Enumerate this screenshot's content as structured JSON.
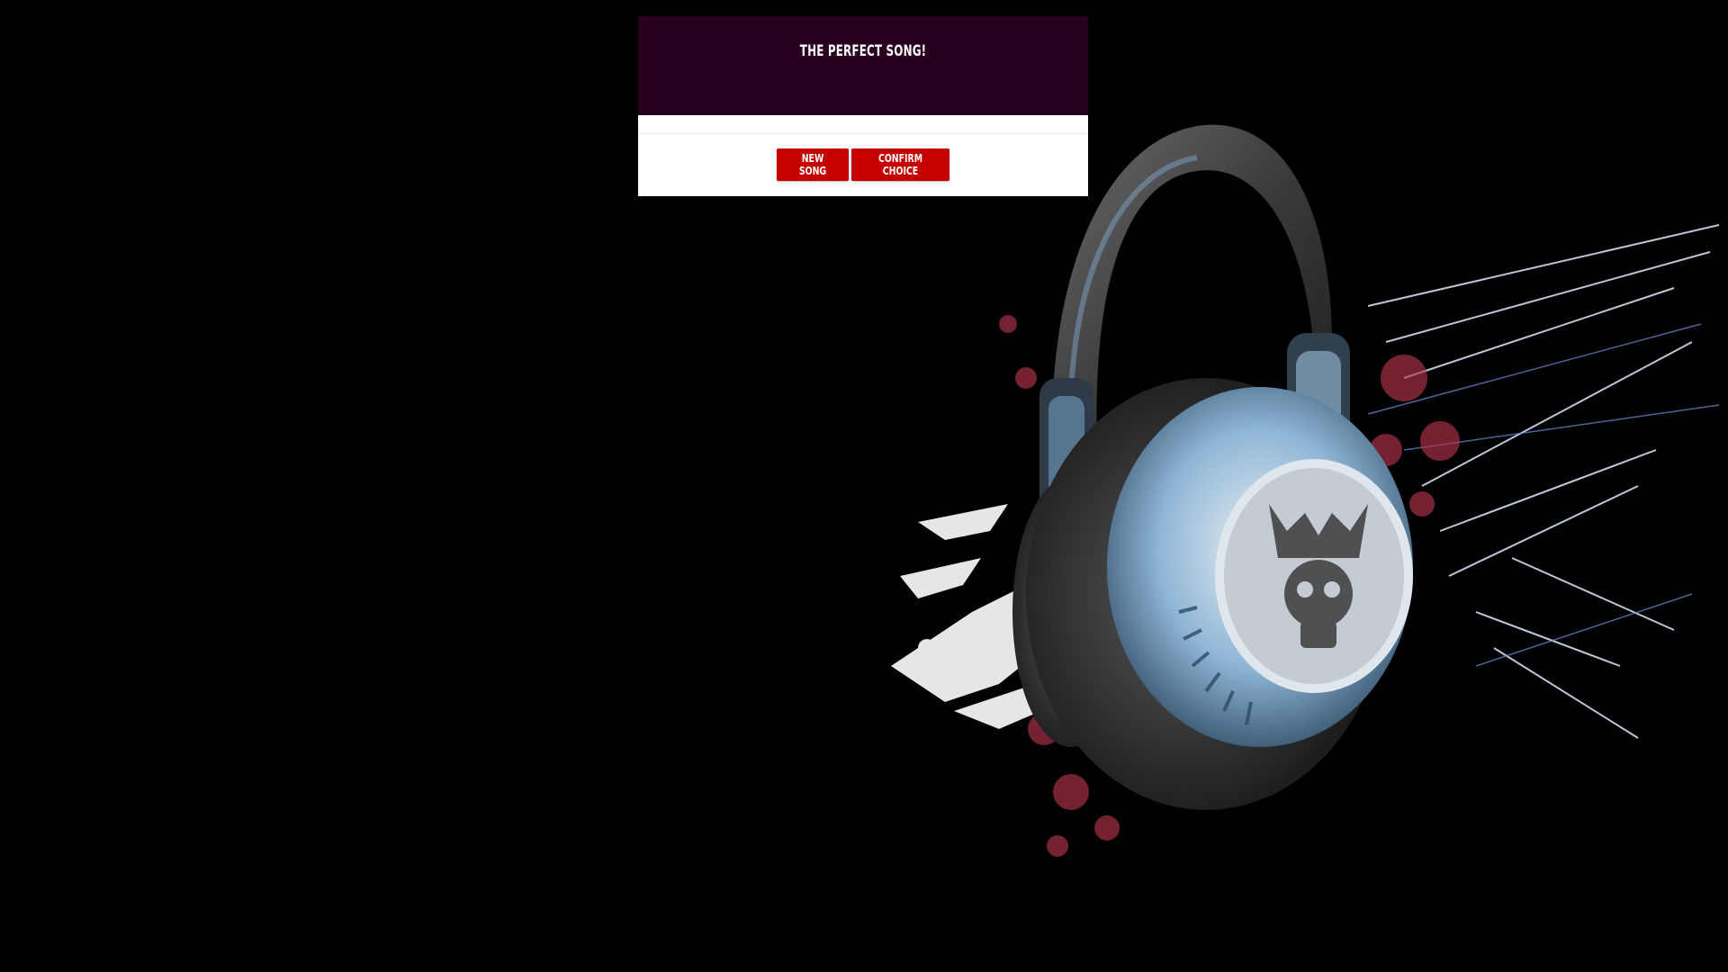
{
  "modal": {
    "title": "The Perfect Song!",
    "buttons": {
      "new_song_label": "New Song",
      "confirm_label": "Confirm Choice"
    }
  },
  "colors": {
    "page_background": "#000000",
    "modal_header": "#2a0021",
    "button": "#c40000",
    "button_text": "#ffffff"
  },
  "background_art": {
    "subject": "headphones-illustration"
  }
}
